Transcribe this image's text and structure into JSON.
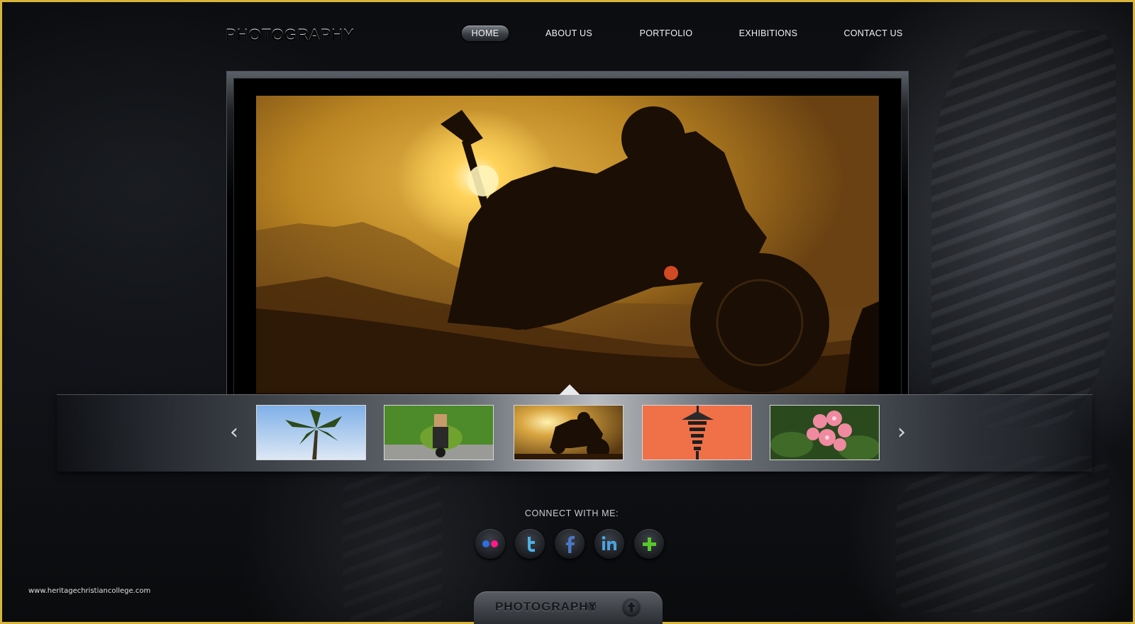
{
  "site": {
    "logo": "PHOTOGRAPHY"
  },
  "nav": {
    "items": [
      {
        "label": "HOME",
        "active": true
      },
      {
        "label": "ABOUT US",
        "active": false
      },
      {
        "label": "PORTFOLIO",
        "active": false
      },
      {
        "label": "EXHIBITIONS",
        "active": false
      },
      {
        "label": "CONTACT US",
        "active": false
      }
    ]
  },
  "slider": {
    "prev_icon": "chevron-left-icon",
    "next_icon": "chevron-right-icon",
    "selected_index": 2
  },
  "connect": {
    "label": "CONNECT WITH ME:",
    "networks": [
      "flickr-icon",
      "twitter-icon",
      "facebook-icon",
      "linkedin-icon",
      "plus-icon"
    ]
  },
  "watermark": "www.heritagechristiancollege.com",
  "footer": {
    "brand": "PHOTOGRAPHY",
    "copyright": "©",
    "top_icon": "arrow-up-icon"
  },
  "colors": {
    "border": "#d8b53a",
    "accent_gold": "#e9b84a"
  }
}
